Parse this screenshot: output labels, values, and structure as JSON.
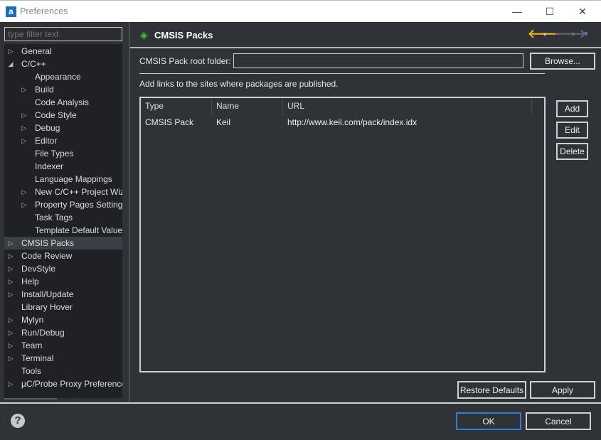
{
  "window": {
    "title": "Preferences",
    "app_icon": "a",
    "minimize": "—",
    "maximize": "☐",
    "close": "✕"
  },
  "filter": {
    "placeholder": "type filter text"
  },
  "tree": [
    {
      "label": "General",
      "level": 0,
      "toggle": "collapsed"
    },
    {
      "label": "C/C++",
      "level": 0,
      "toggle": "expanded"
    },
    {
      "label": "Appearance",
      "level": 1,
      "toggle": "none"
    },
    {
      "label": "Build",
      "level": 1,
      "toggle": "collapsed"
    },
    {
      "label": "Code Analysis",
      "level": 1,
      "toggle": "none"
    },
    {
      "label": "Code Style",
      "level": 1,
      "toggle": "collapsed"
    },
    {
      "label": "Debug",
      "level": 1,
      "toggle": "collapsed"
    },
    {
      "label": "Editor",
      "level": 1,
      "toggle": "collapsed"
    },
    {
      "label": "File Types",
      "level": 1,
      "toggle": "none"
    },
    {
      "label": "Indexer",
      "level": 1,
      "toggle": "none"
    },
    {
      "label": "Language Mappings",
      "level": 1,
      "toggle": "none"
    },
    {
      "label": "New C/C++ Project Wizard",
      "level": 1,
      "toggle": "collapsed"
    },
    {
      "label": "Property Pages Settings",
      "level": 1,
      "toggle": "collapsed"
    },
    {
      "label": "Task Tags",
      "level": 1,
      "toggle": "none"
    },
    {
      "label": "Template Default Values",
      "level": 1,
      "toggle": "none"
    },
    {
      "label": "CMSIS Packs",
      "level": 0,
      "toggle": "collapsed",
      "selected": true
    },
    {
      "label": "Code Review",
      "level": 0,
      "toggle": "collapsed"
    },
    {
      "label": "DevStyle",
      "level": 0,
      "toggle": "collapsed"
    },
    {
      "label": "Help",
      "level": 0,
      "toggle": "collapsed"
    },
    {
      "label": "Install/Update",
      "level": 0,
      "toggle": "collapsed"
    },
    {
      "label": "Library Hover",
      "level": 0,
      "toggle": "none"
    },
    {
      "label": "Mylyn",
      "level": 0,
      "toggle": "collapsed"
    },
    {
      "label": "Run/Debug",
      "level": 0,
      "toggle": "collapsed"
    },
    {
      "label": "Team",
      "level": 0,
      "toggle": "collapsed"
    },
    {
      "label": "Terminal",
      "level": 0,
      "toggle": "collapsed"
    },
    {
      "label": "Tools",
      "level": 0,
      "toggle": "none"
    },
    {
      "label": "µC/Probe Proxy Preferences",
      "level": 0,
      "toggle": "collapsed"
    }
  ],
  "page": {
    "title": "CMSIS Packs",
    "root_label": "CMSIS Pack root folder:",
    "root_value": "",
    "browse": "Browse...",
    "links_label": "Add links to the sites where packages are published.",
    "columns": [
      "Type",
      "Name",
      "URL"
    ],
    "rows": [
      {
        "type": "CMSIS Pack",
        "name": "Keil",
        "url": "http://www.keil.com/pack/index.idx"
      }
    ],
    "add": "Add",
    "edit": "Edit",
    "delete": "Delete",
    "restore": "Restore Defaults",
    "apply": "Apply"
  },
  "footer": {
    "ok": "OK",
    "cancel": "Cancel",
    "help": "?"
  },
  "colors": {
    "accent_back": "#f5b800",
    "tree_bg": "#1f2124",
    "panel_bg": "#2f3237"
  }
}
